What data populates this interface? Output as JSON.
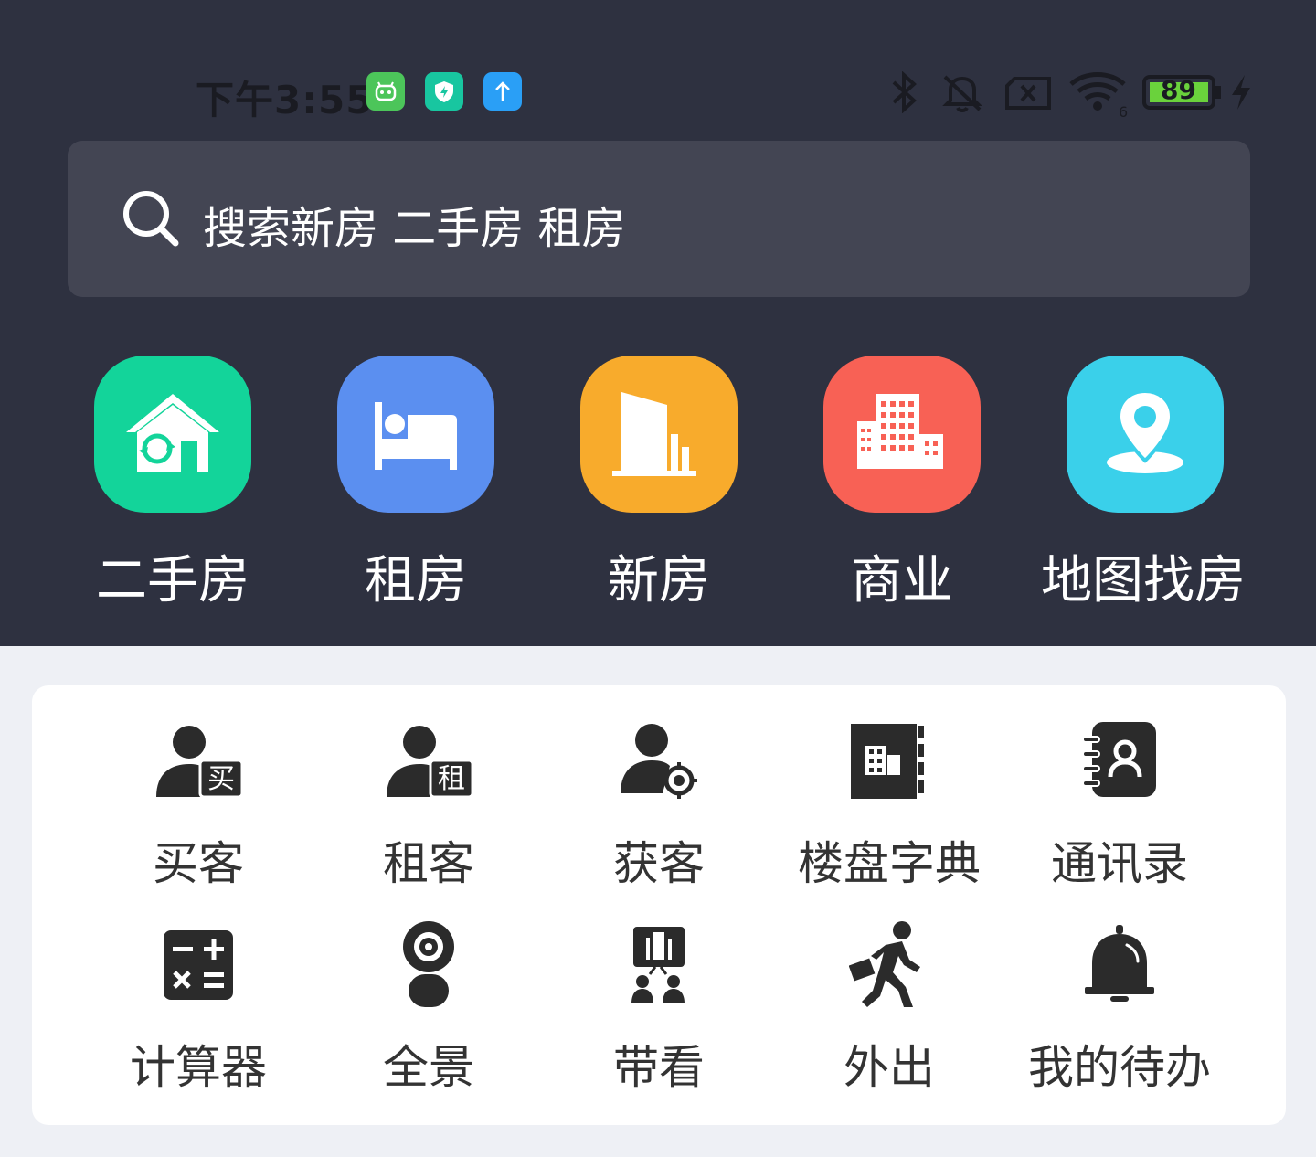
{
  "status_bar": {
    "time": "下午3:55",
    "battery": "89",
    "wifi_sub": "6"
  },
  "search": {
    "placeholder": "搜索新房 二手房 租房"
  },
  "quick_entries": [
    {
      "label": "二手房",
      "icon": "house-sync-icon",
      "color": "#13d49a"
    },
    {
      "label": "租房",
      "icon": "bed-icon",
      "color": "#5b8ff0"
    },
    {
      "label": "新房",
      "icon": "building-icon",
      "color": "#f8ab2c"
    },
    {
      "label": "商业",
      "icon": "office-buildings-icon",
      "color": "#f86155"
    },
    {
      "label": "地图找房",
      "icon": "map-pin-icon",
      "color": "#3ad0ea"
    }
  ],
  "tools": [
    {
      "label": "买客",
      "icon": "buyer-icon",
      "badge": "买"
    },
    {
      "label": "租客",
      "icon": "tenant-icon",
      "badge": "租"
    },
    {
      "label": "获客",
      "icon": "acquire-customer-icon"
    },
    {
      "label": "楼盘字典",
      "icon": "property-dictionary-icon"
    },
    {
      "label": "通讯录",
      "icon": "contacts-icon"
    },
    {
      "label": "计算器",
      "icon": "calculator-icon"
    },
    {
      "label": "全景",
      "icon": "panorama-camera-icon"
    },
    {
      "label": "带看",
      "icon": "viewing-icon"
    },
    {
      "label": "外出",
      "icon": "going-out-icon"
    },
    {
      "label": "我的待办",
      "icon": "bell-icon"
    }
  ]
}
